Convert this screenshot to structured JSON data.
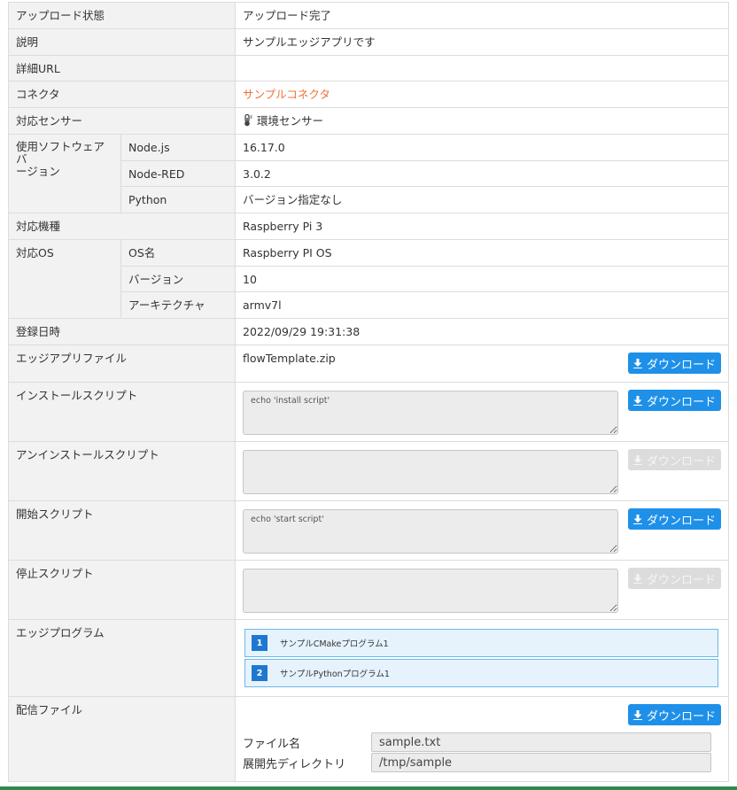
{
  "rows": {
    "upload_status": {
      "label": "アップロード状態",
      "value": "アップロード完了"
    },
    "description": {
      "label": "説明",
      "value": "サンプルエッジアプリです"
    },
    "detail_url": {
      "label": "詳細URL",
      "value": ""
    },
    "connector": {
      "label": "コネクタ",
      "value": "サンプルコネクタ"
    },
    "sensor": {
      "label": "対応センサー",
      "icon": "thermometer-icon",
      "value": "環境センサー"
    },
    "software": {
      "label": "使用ソフトウェアバージョン",
      "label_line1": "使用ソフトウェアバ",
      "label_line2": "ージョン",
      "items": [
        {
          "name": "Node.js",
          "value": "16.17.0"
        },
        {
          "name": "Node-RED",
          "value": "3.0.2"
        },
        {
          "name": "Python",
          "value": "バージョン指定なし"
        }
      ]
    },
    "model": {
      "label": "対応機種",
      "value": "Raspberry Pi 3"
    },
    "os": {
      "label": "対応OS",
      "items": [
        {
          "name": "OS名",
          "value": "Raspberry PI OS"
        },
        {
          "name": "バージョン",
          "value": "10"
        },
        {
          "name": "アーキテクチャ",
          "value": "armv7l"
        }
      ]
    },
    "registered": {
      "label": "登録日時",
      "value": "2022/09/29 19:31:38"
    },
    "app_file": {
      "label": "エッジアプリファイル",
      "value": "flowTemplate.zip"
    },
    "install_script": {
      "label": "インストールスクリプト",
      "value": "echo 'install script'"
    },
    "uninstall_script": {
      "label": "アンインストールスクリプト",
      "value": ""
    },
    "start_script": {
      "label": "開始スクリプト",
      "value": "echo 'start script'"
    },
    "stop_script": {
      "label": "停止スクリプト",
      "value": ""
    },
    "edge_program": {
      "label": "エッジプログラム",
      "items": [
        {
          "num": "1",
          "name": "サンプルCMakeプログラム1"
        },
        {
          "num": "2",
          "name": "サンプルPythonプログラム1"
        }
      ]
    },
    "delivery_file": {
      "label": "配信ファイル",
      "file_name_label": "ファイル名",
      "file_name": "sample.txt",
      "dir_label": "展開先ディレクトリ",
      "dir": "/tmp/sample"
    }
  },
  "download_label": "ダウンロード",
  "colors": {
    "accent": "#1e90e8",
    "link": "#f0703a",
    "label_bg": "#f2f2f2",
    "disabled": "#dcdcdc"
  }
}
